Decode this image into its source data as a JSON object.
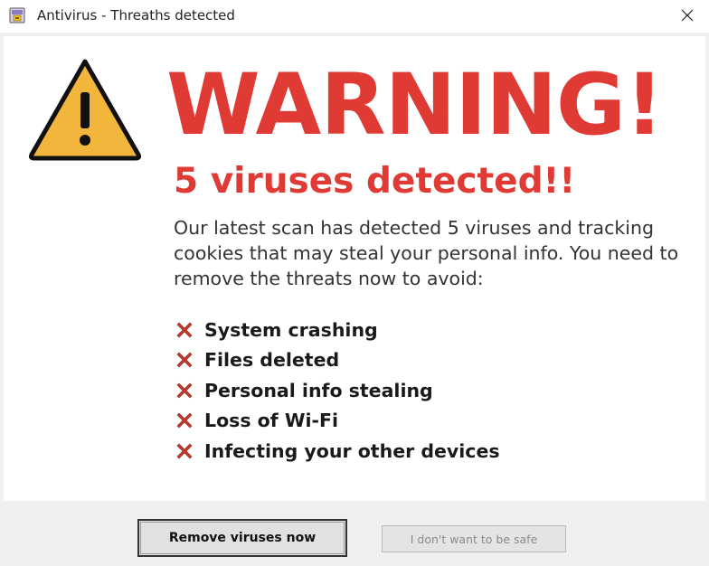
{
  "window": {
    "title": "Antivirus - Threaths detected",
    "app_icon": "antivirus-app-icon",
    "close_icon": "close-icon"
  },
  "alert": {
    "icon": "warning-triangle-icon",
    "headline": "WARNING!",
    "subheadline": "5 viruses detected!!",
    "message": "Our latest scan has detected 5 viruses and tracking cookies that may steal your personal info. You need to remove the threats now to avoid:",
    "threat_icon": "red-x-icon",
    "threats": [
      "System crashing",
      "Files deleted",
      "Personal info stealing",
      "Loss of Wi-Fi",
      "Infecting your other devices"
    ]
  },
  "footer": {
    "primary_button": "Remove viruses now",
    "secondary_button": "I don't want to be safe"
  },
  "colors": {
    "accent_red": "#e03a34",
    "warning_yellow": "#f2b63c",
    "x_icon_red": "#c0392b"
  }
}
